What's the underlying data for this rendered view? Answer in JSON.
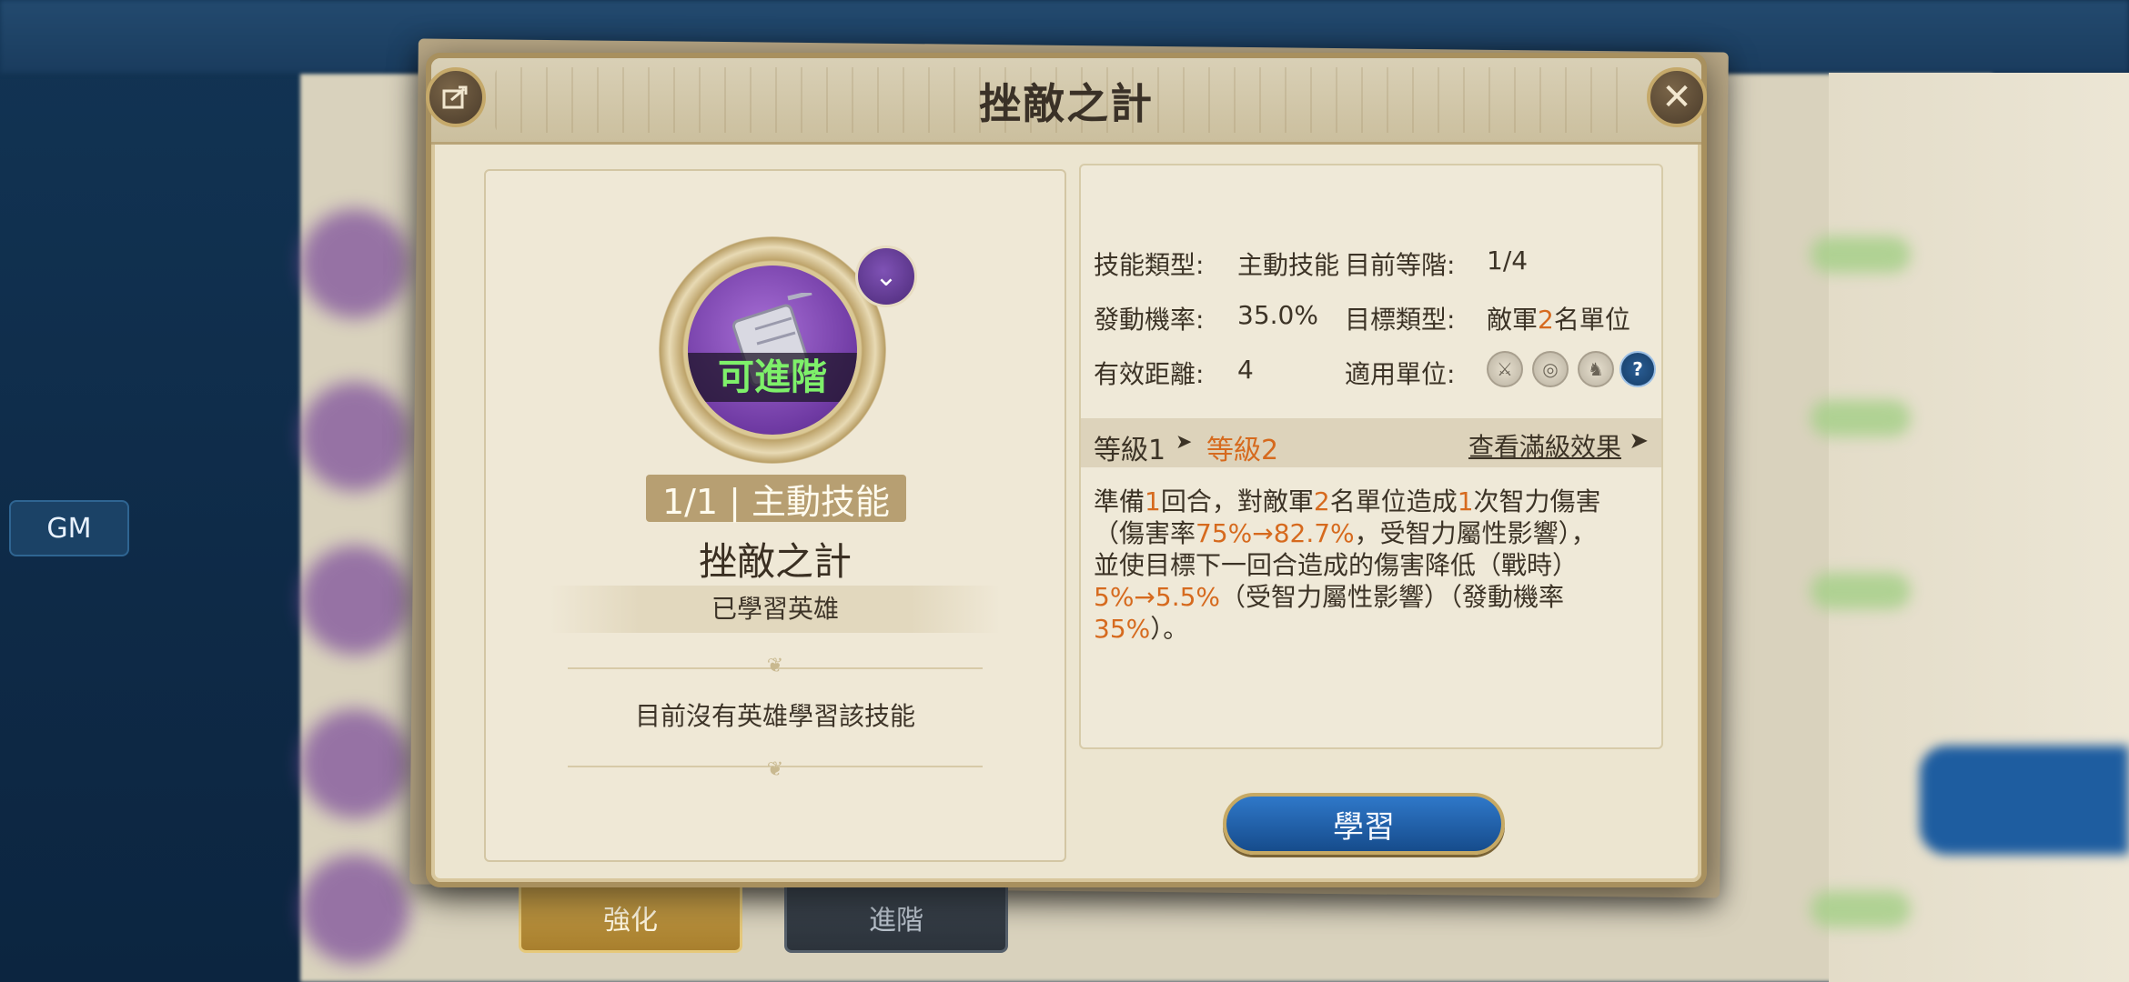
{
  "gm_button": "GM",
  "tabs": {
    "strengthen": "強化",
    "advance": "進階"
  },
  "dialog": {
    "title": "挫敵之計",
    "skill_card": {
      "can_advance_label": "可進階",
      "level_badge": "1/1 | 主動技能",
      "skill_name": "挫敵之計",
      "learned_heroes_label": "已學習英雄",
      "no_hero_text": "目前沒有英雄學習該技能"
    },
    "info": {
      "skill_type_label": "技能類型:",
      "skill_type_value": "主動技能",
      "current_rank_label": "目前等階:",
      "current_rank_value": "1/4",
      "trigger_rate_label": "發動機率:",
      "trigger_rate_value": "35.0%",
      "target_type_label": "目標類型:",
      "target_type_prefix": "敵軍",
      "target_type_count": "2",
      "target_type_suffix": "名單位",
      "range_label": "有效距離:",
      "range_value": "4",
      "applicable_units_label": "適用單位:",
      "unit_icons": [
        "sword-icon",
        "target-icon",
        "horse-icon",
        "question-icon"
      ]
    },
    "level_bar": {
      "current": "等級1",
      "arrow": "➤",
      "next": "等級2",
      "max_link": "查看滿級效果",
      "max_arrow": "➤"
    },
    "description": {
      "p1": "準備",
      "p2": "1",
      "p3": "回合，對敵軍",
      "p4": "2",
      "p5": "名單位造成",
      "p6": "1",
      "p7": "次智力傷害",
      "p8": "（傷害率",
      "p9": "75%→82.7%",
      "p10": "，受智力屬性影響），",
      "p11": "並使目標下一回合造成的傷害降低（戰時）",
      "p12": "5%→5.5%",
      "p13": "（受智力屬性影響）（發動機率",
      "p14": "35%",
      "p15": "）。"
    },
    "learn_button": "學習"
  },
  "colors": {
    "highlight": "#d66a1e",
    "can_advance": "#7ef06a",
    "learn_button": "#1f5fa8"
  }
}
